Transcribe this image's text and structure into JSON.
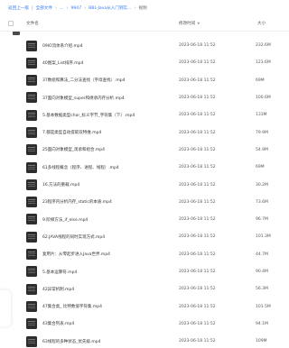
{
  "breadcrumb": {
    "back": "返回上一级",
    "items": [
      "全部文件",
      "...",
      "9947",
      "BBL·Java从入门到实...",
      "视频"
    ]
  },
  "header": {
    "name": "文件名",
    "time": "修改时间",
    "size": "大小"
  },
  "files": [
    {
      "name": "09IO流体系介绍.mp4",
      "time": "2023-06-18 11:52",
      "size": "232.6M"
    },
    {
      "name": "40图案_List排序.mp4",
      "time": "2023-06-18 11:52",
      "size": "123.6M"
    },
    {
      "name": "37数组和算法_二分法查找（字母查找）.mp4",
      "time": "2023-06-18 11:52",
      "size": "69M"
    },
    {
      "name": "37面向对象模型_super和继承内存分析.mp4",
      "time": "2023-06-18 11:52",
      "size": "100.6M"
    },
    {
      "name": "5.基本数据类型char_标义字节_字符集（下）.mp4",
      "time": "2023-06-18 11:52",
      "size": "133M"
    },
    {
      "name": "7.都是类型自动提取双特维.mp4",
      "time": "2023-06-18 11:52",
      "size": "79.9M"
    },
    {
      "name": "25面向对象模型_现承和组合.mp4",
      "time": "2023-06-18 11:52",
      "size": "54.9M"
    },
    {
      "name": "61多线程概念（程序、进程、线程）.mp4",
      "time": "2023-06-18 11:52",
      "size": "69M"
    },
    {
      "name": "16.方法的重载.mp4",
      "time": "2023-06-18 11:52",
      "size": "30.2M"
    },
    {
      "name": "23程序内分析内存_static的本质.mp4",
      "time": "2023-06-18 11:52",
      "size": "73.6M"
    },
    {
      "name": "9.阶梯方法_if_else.mp4",
      "time": "2023-06-18 11:52",
      "size": "96.7M"
    },
    {
      "name": "62.JAVA线程的同时实现方式.mp4",
      "time": "2023-06-18 11:52",
      "size": "101.3M"
    },
    {
      "name": "复用片：从零起步进入Java世界.mp4",
      "time": "2023-06-18 11:52",
      "size": "44.7M"
    },
    {
      "name": "5.基本运算符.mp4",
      "time": "2023-06-18 11:52",
      "size": "90.4M"
    },
    {
      "name": "42异常机制.mp4",
      "time": "2023-06-18 11:52",
      "size": "56.3M"
    },
    {
      "name": "47集合类_ 比特数值字符集.mp4",
      "time": "2023-06-18 11:52",
      "size": "101.5M"
    },
    {
      "name": "43集合列表.mp4",
      "time": "2023-06-18 11:52",
      "size": "94.1M"
    },
    {
      "name": "63线程的多种状态_优先级.mp4",
      "time": "2023-06-18 11:52",
      "size": "109M"
    }
  ]
}
